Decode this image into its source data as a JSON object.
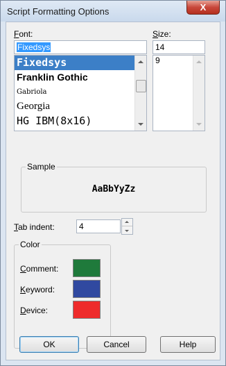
{
  "window": {
    "title": "Script Formatting Options",
    "close_glyph": "X"
  },
  "font": {
    "label": "Font:",
    "value": "Fixedsys",
    "list": [
      {
        "name": "Fixedsys",
        "selected": true
      },
      {
        "name": "Franklin Gothic",
        "selected": false
      },
      {
        "name": "Gabriola",
        "selected": false
      },
      {
        "name": "Georgia",
        "selected": false
      },
      {
        "name": "HG IBM(8x16)",
        "selected": false
      }
    ]
  },
  "size": {
    "label": "Size:",
    "value": "14",
    "list": [
      "9"
    ]
  },
  "sample": {
    "title": "Sample",
    "text": "AaBbYyZz"
  },
  "tab_indent": {
    "label": "Tab indent:",
    "value": "4"
  },
  "color": {
    "title": "Color",
    "items": [
      {
        "label": "Comment:",
        "color": "#1f7a3b"
      },
      {
        "label": "Keyword:",
        "color": "#3049a0"
      },
      {
        "label": "Device:",
        "color": "#ee2b2b"
      }
    ]
  },
  "buttons": {
    "ok": "OK",
    "cancel": "Cancel",
    "help": "Help"
  }
}
